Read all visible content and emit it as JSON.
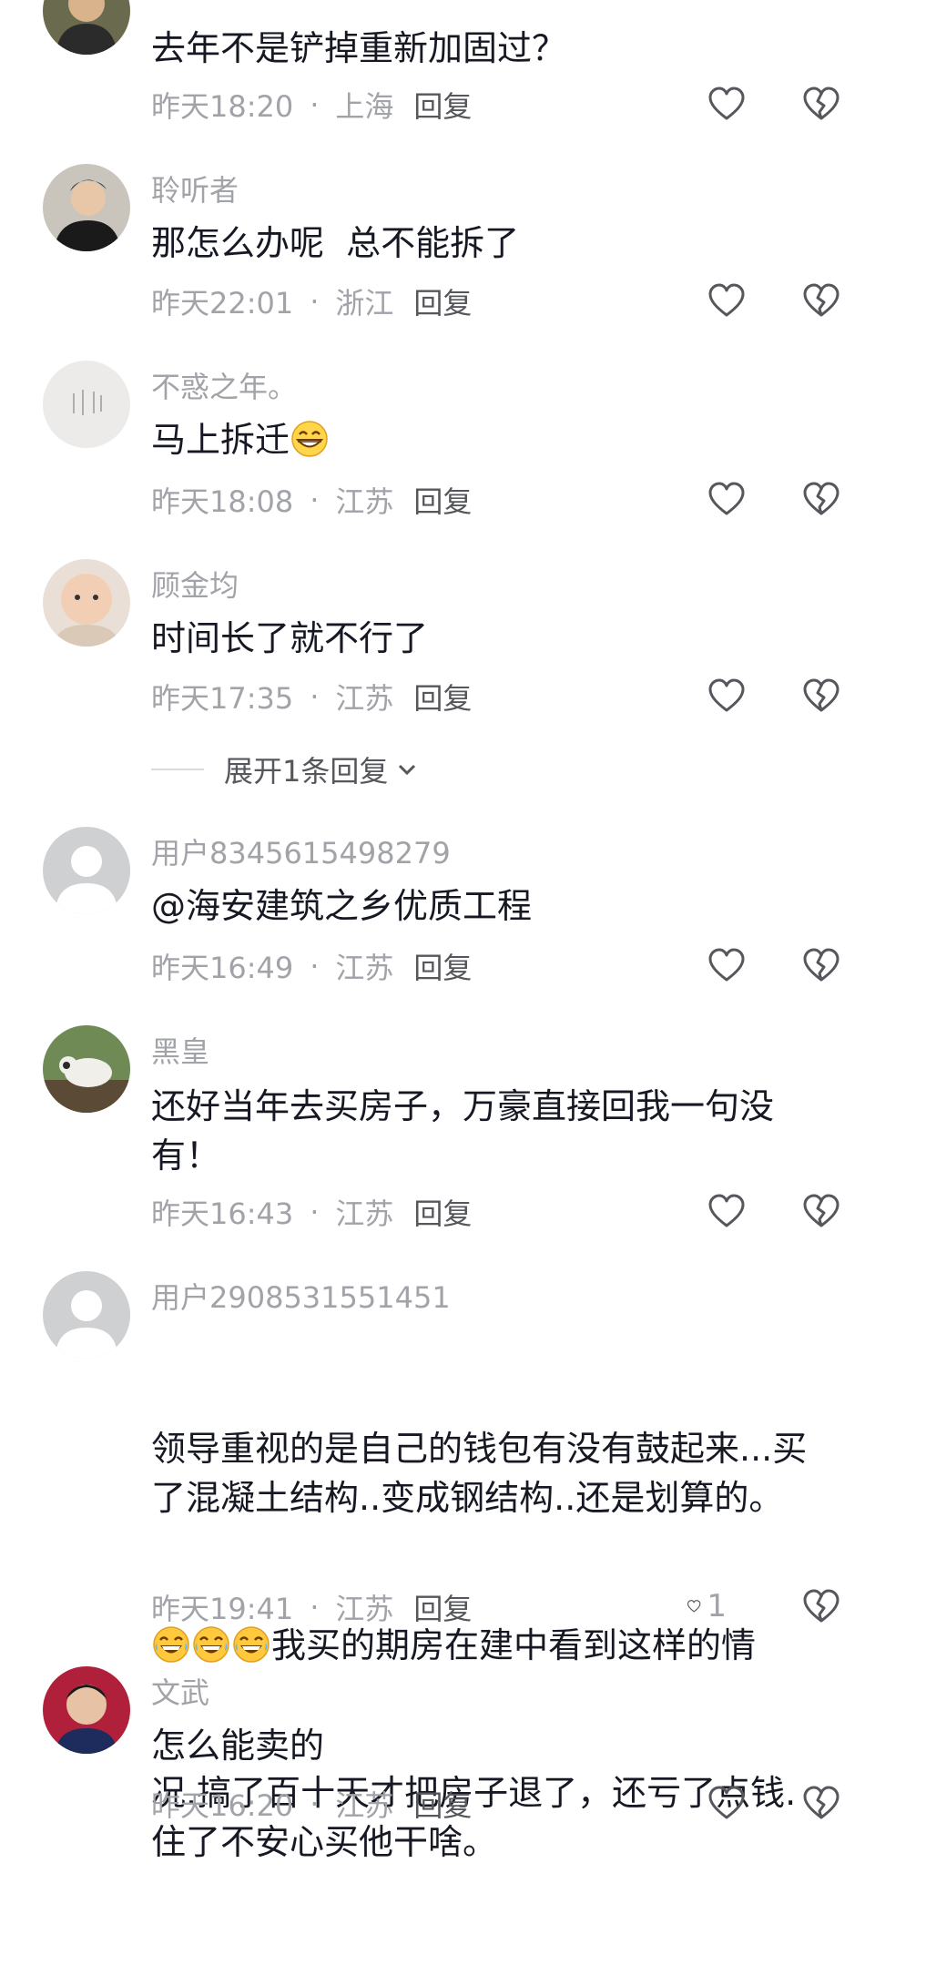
{
  "comments": [
    {
      "username": "",
      "text": "去年不是铲掉重新加固过？",
      "time": "昨天18:20",
      "location": "上海",
      "reply": "回复",
      "likes": ""
    },
    {
      "username": "聆听者",
      "text": "那怎么办呢  总不能拆了",
      "time": "昨天22:01",
      "location": "浙江",
      "reply": "回复",
      "likes": ""
    },
    {
      "username": "不惑之年。",
      "text": "马上拆迁",
      "time": "昨天18:08",
      "location": "江苏",
      "reply": "回复",
      "likes": ""
    },
    {
      "username": "顾金均",
      "text": "时间长了就不行了",
      "time": "昨天17:35",
      "location": "江苏",
      "reply": "回复",
      "likes": ""
    },
    {
      "username": "用户8345615498279",
      "text": "@海安建筑之乡优质工程",
      "time": "昨天16:49",
      "location": "江苏",
      "reply": "回复",
      "likes": ""
    },
    {
      "username": "黑皇",
      "text": "还好当年去买房子，万豪直接回我一句没\n有！",
      "time": "昨天16:43",
      "location": "江苏",
      "reply": "回复",
      "likes": ""
    },
    {
      "username": "用户2908531551451",
      "text_line1": "领导重视的是自己的钱包有没有鼓起来...买\n了混凝土结构..变成钢结构..还是划算的。",
      "text_line2": "我买的期房在建中看到这样的情",
      "text_line3": "况.搞了百十天才把房子退了，还亏了点钱.\n住了不安心买他干啥。",
      "time": "昨天19:41",
      "location": "江苏",
      "reply": "回复",
      "likes": "1"
    },
    {
      "username": "文武",
      "text": "怎么能卖的",
      "time": "昨天16:20",
      "location": "江苏",
      "reply": "回复",
      "likes": ""
    }
  ],
  "expand_replies": "展开1条回复",
  "separator": "·",
  "icons": {
    "like": "heart-outline-icon",
    "dislike": "broken-heart-icon",
    "expand": "chevron-down-icon"
  },
  "colors": {
    "text": "#161823",
    "meta": "#a1a3a8",
    "reply": "#55575c"
  }
}
